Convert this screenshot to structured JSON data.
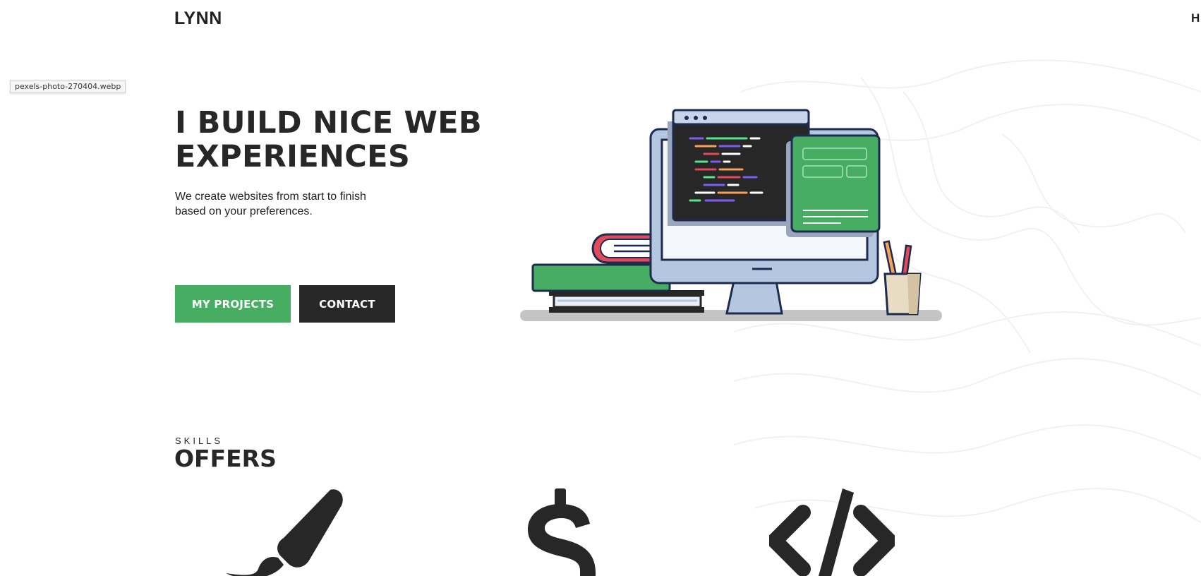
{
  "header": {
    "logo": "LYNN",
    "nav_partial": "H"
  },
  "tooltip": "pexels-photo-270404.webp",
  "hero": {
    "title": "I BUILD NICE WEB EXPERIENCES",
    "subtitle": "We create websites from start to finish based on your preferences.",
    "primary_button": "MY PROJECTS",
    "secondary_button": "CONTACT"
  },
  "skills": {
    "eyebrow": "SKILLS",
    "heading": "OFFERS"
  },
  "offer_icons": [
    "brush-icon",
    "dollar-icon",
    "code-icon"
  ],
  "colors": {
    "accent": "#47ad62",
    "dark": "#272727",
    "monitor": "#b5c6e0",
    "outline": "#1d2b4f"
  }
}
